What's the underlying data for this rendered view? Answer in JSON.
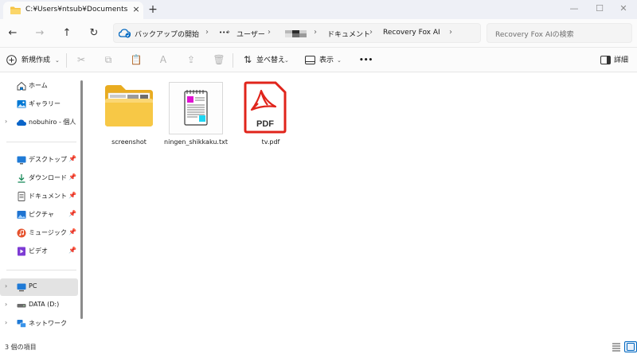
{
  "tab": {
    "title": "C:¥Users¥ntsub¥Documents¥F",
    "close": "×",
    "new_tab": "+"
  },
  "window_controls": {
    "minimize": "—",
    "maximize": "☐",
    "close": "✕"
  },
  "nav": {
    "back": "←",
    "forward": "→",
    "up": "↑",
    "refresh": "↻"
  },
  "breadcrumb": {
    "backup_label": "バックアップの開始",
    "more": "•••",
    "user": "ユーザー",
    "documents": "ドキュメント",
    "current": "Recovery Fox AI",
    "separator": "›"
  },
  "search": {
    "placeholder": "Recovery Fox AIの検索"
  },
  "toolbar": {
    "new_label": "新規作成",
    "sort_label": "並べ替え",
    "view_label": "表示",
    "more": "•••",
    "details_label": "詳細"
  },
  "sidebar": {
    "items": [
      {
        "label": "ホーム"
      },
      {
        "label": "ギャラリー"
      },
      {
        "label": "nobuhiro - 個人"
      },
      {
        "label": "デスクトップ"
      },
      {
        "label": "ダウンロード"
      },
      {
        "label": "ドキュメント"
      },
      {
        "label": "ピクチャ"
      },
      {
        "label": "ミュージック"
      },
      {
        "label": "ビデオ"
      },
      {
        "label": "PC"
      },
      {
        "label": "DATA (D:)"
      },
      {
        "label": "ネットワーク"
      }
    ]
  },
  "files": [
    {
      "name": "screenshot",
      "type": "folder"
    },
    {
      "name": "ningen_shikkaku.txt",
      "type": "text"
    },
    {
      "name": "tv.pdf",
      "type": "pdf",
      "badge": "PDF"
    }
  ],
  "status": {
    "count_text": "3 個の項目"
  },
  "colors": {
    "accent": "#0067c0",
    "folder": "#f6c343",
    "pdf": "#e0241b"
  }
}
